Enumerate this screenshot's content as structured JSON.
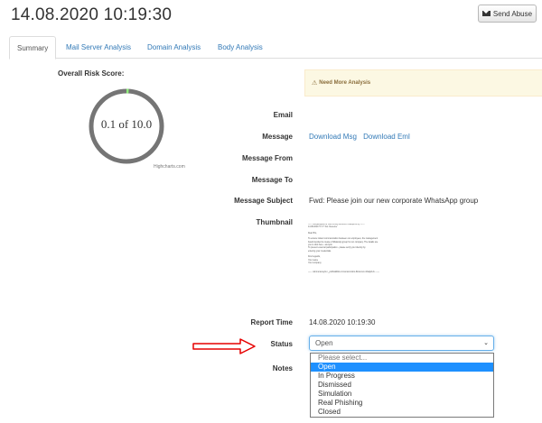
{
  "header": {
    "title": "14.08.2020 10:19:30",
    "send_abuse_label": "Send Abuse"
  },
  "tabs": [
    {
      "label": "Summary",
      "active": true
    },
    {
      "label": "Mail Server Analysis",
      "active": false
    },
    {
      "label": "Domain Analysis",
      "active": false
    },
    {
      "label": "Body Analysis",
      "active": false
    }
  ],
  "risk": {
    "label": "Overall Risk Score:",
    "score_text": "0.1 of 10.0",
    "score": 0.1,
    "max": 10.0,
    "credits": "Highcharts.com"
  },
  "alert": {
    "text": "Need More Analysis",
    "icon": "warning-icon"
  },
  "fields": {
    "email": {
      "label": "Email",
      "value": ""
    },
    "message": {
      "label": "Message",
      "download_msg": "Download Msg",
      "download_eml": "Download Eml"
    },
    "message_from": {
      "label": "Message From",
      "value": ""
    },
    "message_to": {
      "label": "Message To",
      "value": ""
    },
    "message_subject": {
      "label": "Message Subject",
      "value": "Fwd: Please join our new corporate WhatsApp group"
    },
    "thumbnail": {
      "label": "Thumbnail"
    },
    "report_time": {
      "label": "Report Time",
      "value": "14.08.2020 10:19:30"
    },
    "status": {
      "label": "Status",
      "selected": "Open",
      "options": [
        "Please select...",
        "Open",
        "In Progress",
        "Dismissed",
        "Simulation",
        "Real Phishing",
        "Closed"
      ]
    },
    "notes": {
      "label": "Notes"
    }
  },
  "thumbnail_lines": [
    "------ xkfsjdklsjdkfs dr bud szcvxy.llkmsnxm.nflukjsll.ck.sy ------",
    "14.08.2020 '5 '1'7 'Fw: Deneme'",
    "",
    "Dear Bro,",
    "",
    "To ensure instant communication between our employees, the management",
    "board decided to create a WhatsApp group for our company. The details are",
    "you to click here - and join.",
    "To prevent external participation - please verify your identity by",
    "entering your credentials.",
    "",
    "Kind regards,",
    "Your name",
    "Your company",
    "",
    "",
    "------ rslnmunsnuylo.n_yvdrkkk4llsl-nr-lnsmsmmrkm-flkmsnxm.nflukjsll.ck ------"
  ],
  "colors": {
    "gauge_track": "#757575",
    "gauge_fill": "#90ed7d",
    "link": "#337ab7",
    "selected_option": "#1e90ff",
    "arrow": "#e60000"
  }
}
